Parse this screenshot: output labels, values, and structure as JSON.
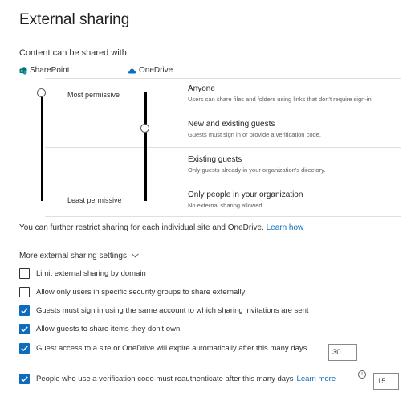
{
  "header": {
    "title": "External sharing"
  },
  "content_sharing": {
    "label": "Content can be shared with:",
    "sharepoint_label": "SharePoint",
    "onedrive_label": "OneDrive",
    "sharepoint_level": "Anyone",
    "onedrive_level": "New and existing guests",
    "most_permissive_label": "Most permissive",
    "least_permissive_label": "Least permissive",
    "levels": [
      {
        "title": "Anyone",
        "description": "Users can share files and folders using links that don't require sign-in."
      },
      {
        "title": "New and existing guests",
        "description": "Guests must sign in or provide a verification code."
      },
      {
        "title": "Existing guests",
        "description": "Only guests already in your organization's directory."
      },
      {
        "title": "Only people in your organization",
        "description": "No external sharing allowed."
      }
    ]
  },
  "restrict_text": "You can further restrict sharing for each individual site and OneDrive.",
  "learn_how_link": "Learn how",
  "more_settings": {
    "label": "More external sharing settings",
    "options": [
      {
        "label": "Limit external sharing by domain",
        "checked": false
      },
      {
        "label": "Allow only users in specific security groups to share externally",
        "checked": false
      },
      {
        "label": "Guests must sign in using the same account to which sharing invitations are sent",
        "checked": true
      },
      {
        "label": "Allow guests to share items they don't own",
        "checked": true
      },
      {
        "label": "Guest access to a site or OneDrive will expire automatically after this many days",
        "checked": true,
        "value": "30"
      },
      {
        "label": "People who use a verification code must reauthenticate after this many days",
        "checked": true,
        "value": "15",
        "link": "Learn more"
      }
    ]
  },
  "colors": {
    "accent": "#0f6cbd",
    "text": "#323130",
    "divider": "#e1dfdd"
  }
}
